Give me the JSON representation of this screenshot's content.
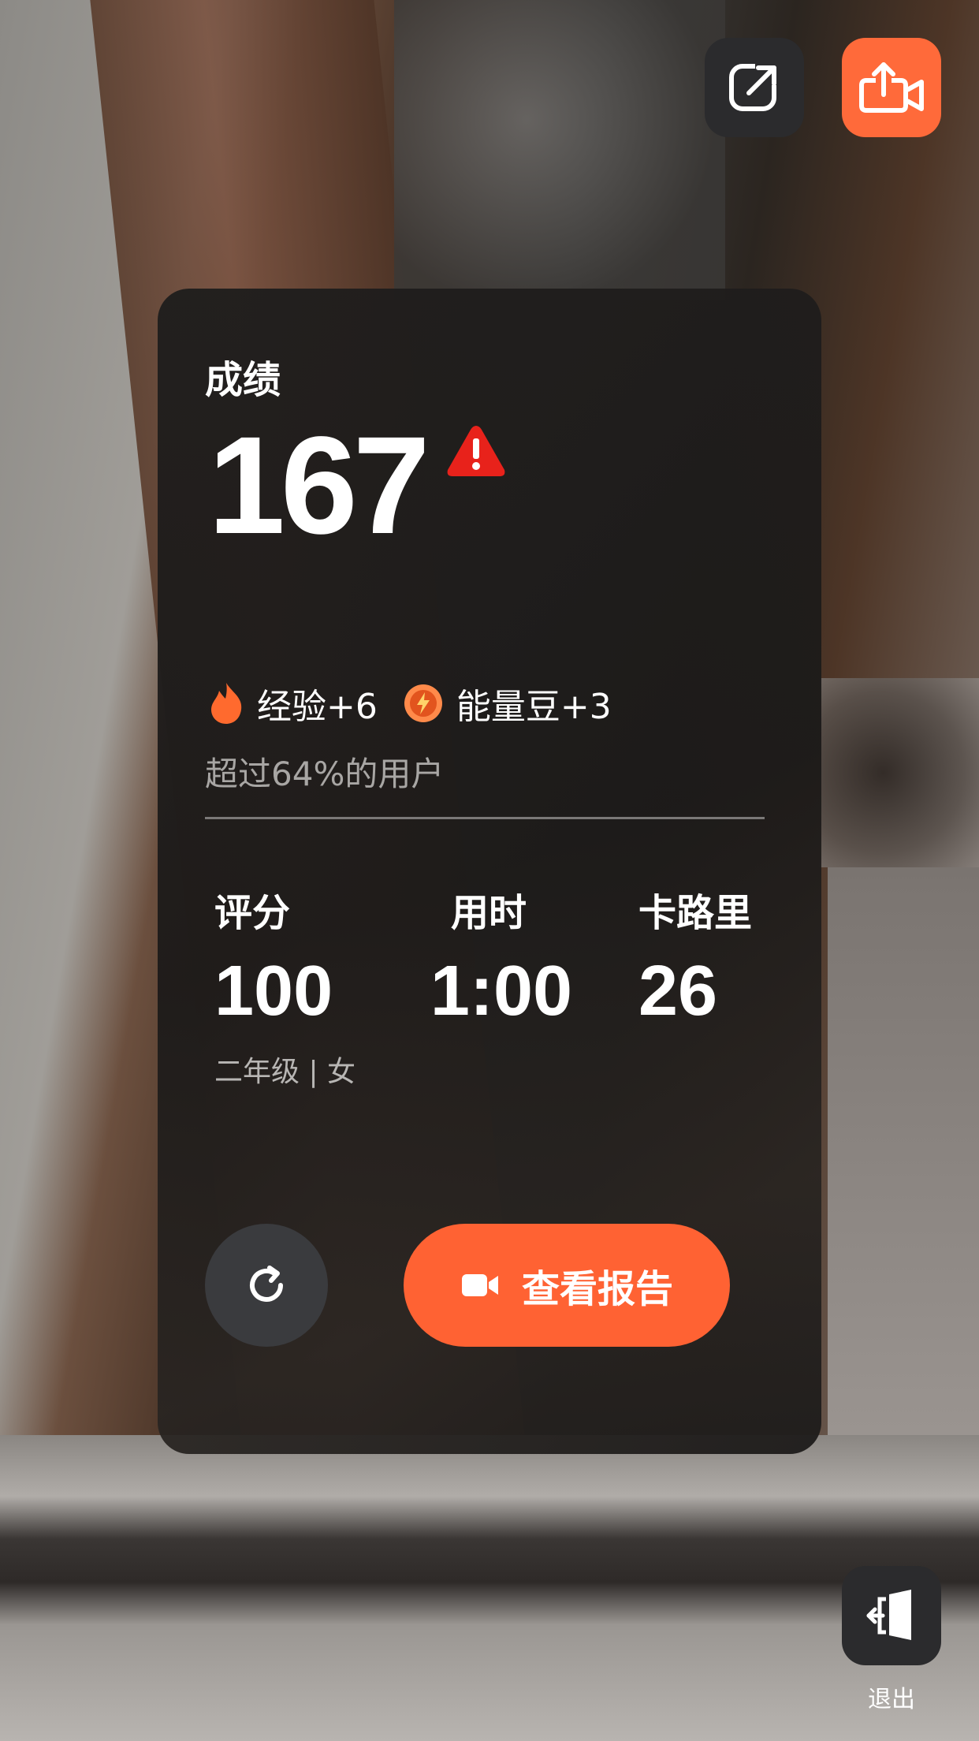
{
  "top_bar": {
    "open_icon": "open-external-icon",
    "share_icon": "video-share-icon",
    "accent": "#ff6a3a"
  },
  "card": {
    "title": "成绩",
    "score": "167",
    "warning_icon": "warning-icon",
    "rewards": {
      "exp_icon": "fire-icon",
      "exp_text": "经验+6",
      "energy_icon": "energy-bean-icon",
      "energy_text": "能量豆+3"
    },
    "exceed_text": "超过64%的用户",
    "stats": [
      {
        "label": "评分",
        "value": "100"
      },
      {
        "label": "用时",
        "value": "1:00"
      },
      {
        "label": "卡路里",
        "value": "26"
      }
    ],
    "profile": "二年级 | 女",
    "retry_icon": "refresh-icon",
    "report_button": {
      "icon": "video-camera-icon",
      "label": "查看报告",
      "color": "#ff6233"
    }
  },
  "exit": {
    "icon": "exit-door-icon",
    "label": "退出"
  }
}
